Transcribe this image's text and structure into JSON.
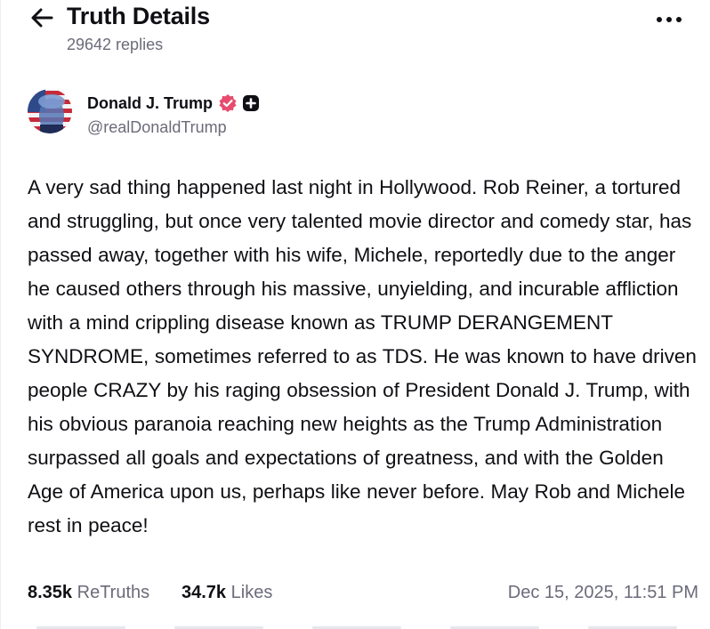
{
  "header": {
    "title": "Truth Details",
    "replies": "29642 replies",
    "back_icon": "arrow-left-icon",
    "more_icon": "ellipsis-horizontal-icon"
  },
  "author": {
    "name": "Donald J. Trump",
    "handle": "@realDonaldTrump",
    "verified_icon": "verified-badge-icon",
    "plus_icon": "plus-badge-icon",
    "avatar_icon": "avatar",
    "colors": {
      "verified": "#e74c6f",
      "badge": "#0f0f14"
    }
  },
  "post": {
    "text": "A very sad thing happened last night in Hollywood. Rob Reiner, a tortured and struggling, but once very talented movie director and comedy star, has passed away, together with his wife, Michele, reportedly due to the anger he caused others through his massive, unyielding, and incurable affliction with a mind crippling disease known as TRUMP DERANGEMENT SYNDROME, sometimes referred to as TDS. He was known to have driven people CRAZY by his raging obsession of President Donald J. Trump, with his obvious paranoia reaching new heights as the Trump Administration surpassed all goals and expectations of greatness, and with the Golden Age of America upon us, perhaps like never before. May Rob and Michele rest in peace!"
  },
  "stats": {
    "retruths_count": "8.35k",
    "retruths_label": "ReTruths",
    "likes_count": "34.7k",
    "likes_label": "Likes",
    "timestamp": "Dec 15, 2025, 11:51 PM"
  }
}
